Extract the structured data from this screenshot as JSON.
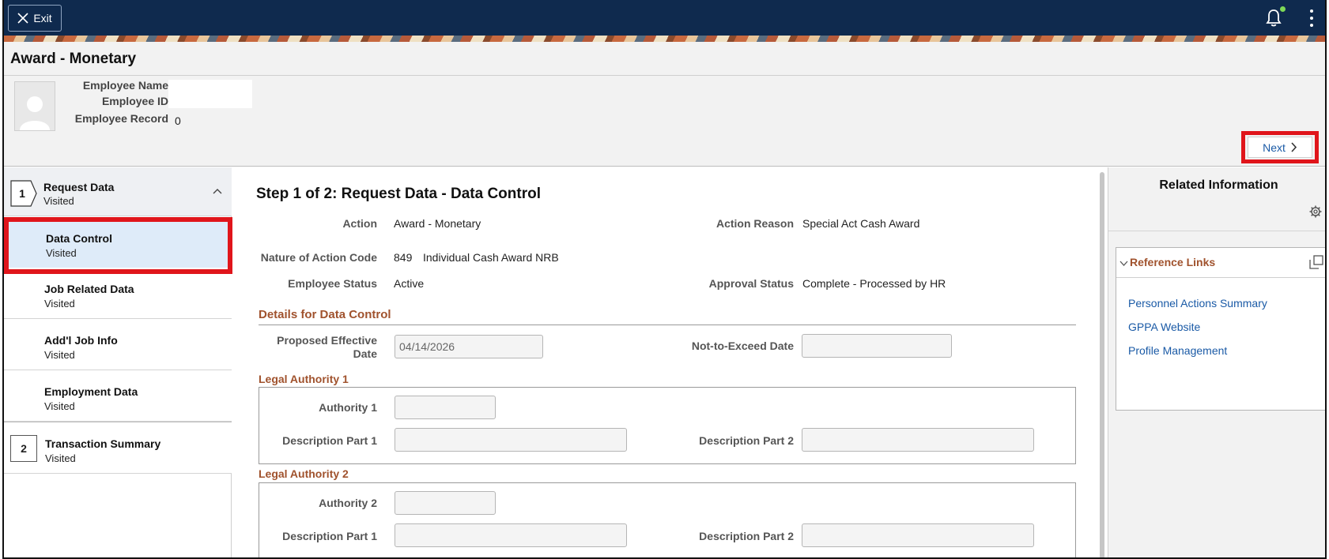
{
  "topbar": {
    "exit_label": "Exit"
  },
  "page": {
    "title": "Award - Monetary"
  },
  "employee": {
    "name_label": "Employee Name",
    "id_label": "Employee ID",
    "record_label": "Employee Record",
    "record_value": "0"
  },
  "actions": {
    "next_label": "Next"
  },
  "nav": {
    "step1": {
      "number": "1",
      "title": "Request Data",
      "status": "Visited"
    },
    "items": [
      {
        "title": "Data Control",
        "status": "Visited"
      },
      {
        "title": "Job Related Data",
        "status": "Visited"
      },
      {
        "title": "Add'l Job Info",
        "status": "Visited"
      },
      {
        "title": "Employment Data",
        "status": "Visited"
      }
    ],
    "step2": {
      "number": "2",
      "title": "Transaction Summary",
      "status": "Visited"
    }
  },
  "main": {
    "step_title": "Step 1 of 2: Request Data - Data Control",
    "action_label": "Action",
    "action_value": "Award - Monetary",
    "action_reason_label": "Action Reason",
    "action_reason_value": "Special Act Cash Award",
    "noa_label": "Nature of Action Code",
    "noa_code": "849",
    "noa_desc": "Individual Cash Award NRB",
    "emp_status_label": "Employee Status",
    "emp_status_value": "Active",
    "approval_label": "Approval Status",
    "approval_value": "Complete - Processed by HR",
    "details_title": "Details for Data Control",
    "eff_date_label_1": "Proposed Effective",
    "eff_date_label_2": "Date",
    "eff_date_value": "04/14/2026",
    "nte_label": "Not-to-Exceed Date",
    "nte_value": "",
    "legal1_title": "Legal Authority 1",
    "authority1_label": "Authority 1",
    "legal2_title": "Legal Authority 2",
    "authority2_label": "Authority 2",
    "desc1_label": "Description Part 1",
    "desc2_label": "Description Part 2"
  },
  "related": {
    "title": "Related Information",
    "ref_title": "Reference Links",
    "links": [
      "Personnel Actions Summary",
      "GPPA Website",
      "Profile Management"
    ]
  },
  "colors": {
    "navy": "#0f2a4e",
    "highlight": "#e0151b",
    "section": "#a0522d",
    "link": "#1a5aa6"
  }
}
